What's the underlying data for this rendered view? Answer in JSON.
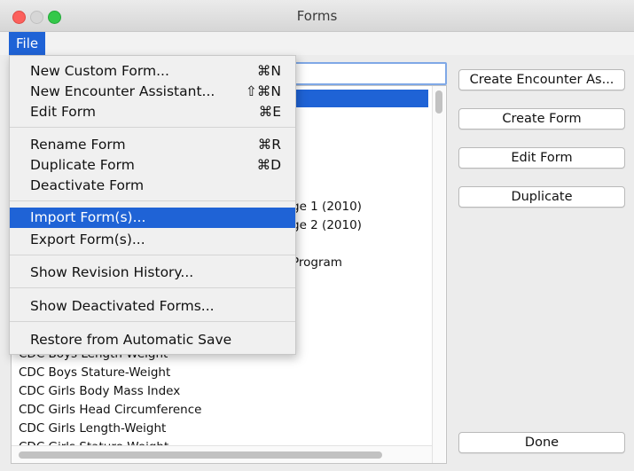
{
  "window": {
    "title": "Forms"
  },
  "menubar": {
    "file_label": "File"
  },
  "file_menu": {
    "items": [
      {
        "label": "New Custom Form...",
        "shortcut": "⌘N"
      },
      {
        "label": "New Encounter Assistant...",
        "shortcut": "⇧⌘N"
      },
      {
        "label": "Edit Form",
        "shortcut": "⌘E"
      },
      {
        "label": "Rename Form",
        "shortcut": "⌘R"
      },
      {
        "label": "Duplicate Form",
        "shortcut": "⌘D"
      },
      {
        "label": "Deactivate Form",
        "shortcut": ""
      },
      {
        "label": "Import Form(s)...",
        "shortcut": ""
      },
      {
        "label": "Export Form(s)...",
        "shortcut": ""
      },
      {
        "label": "Show Revision History...",
        "shortcut": ""
      },
      {
        "label": "Show Deactivated Forms...",
        "shortcut": ""
      },
      {
        "label": "Restore from Automatic Save",
        "shortcut": ""
      }
    ],
    "highlighted_item": "Import Form(s)..."
  },
  "forms_list": {
    "search_value": "",
    "partial_items": [
      "ge 1 (2010)",
      "ge 2 (2010)",
      "Program"
    ],
    "items": [
      "CDC Boys Length-Weight",
      "CDC Boys Stature-Weight",
      "CDC Girls Body Mass Index",
      "CDC Girls Head Circumference",
      "CDC Girls Length-Weight",
      "CDC Girls Stature-Weight"
    ]
  },
  "buttons": {
    "create_encounter": "Create Encounter As...",
    "create_form": "Create Form",
    "edit_form": "Edit Form",
    "duplicate": "Duplicate",
    "done": "Done"
  },
  "colors": {
    "selection": "#1f63d6",
    "menu_bg": "#f0f0f0",
    "window_bg": "#ececec"
  }
}
